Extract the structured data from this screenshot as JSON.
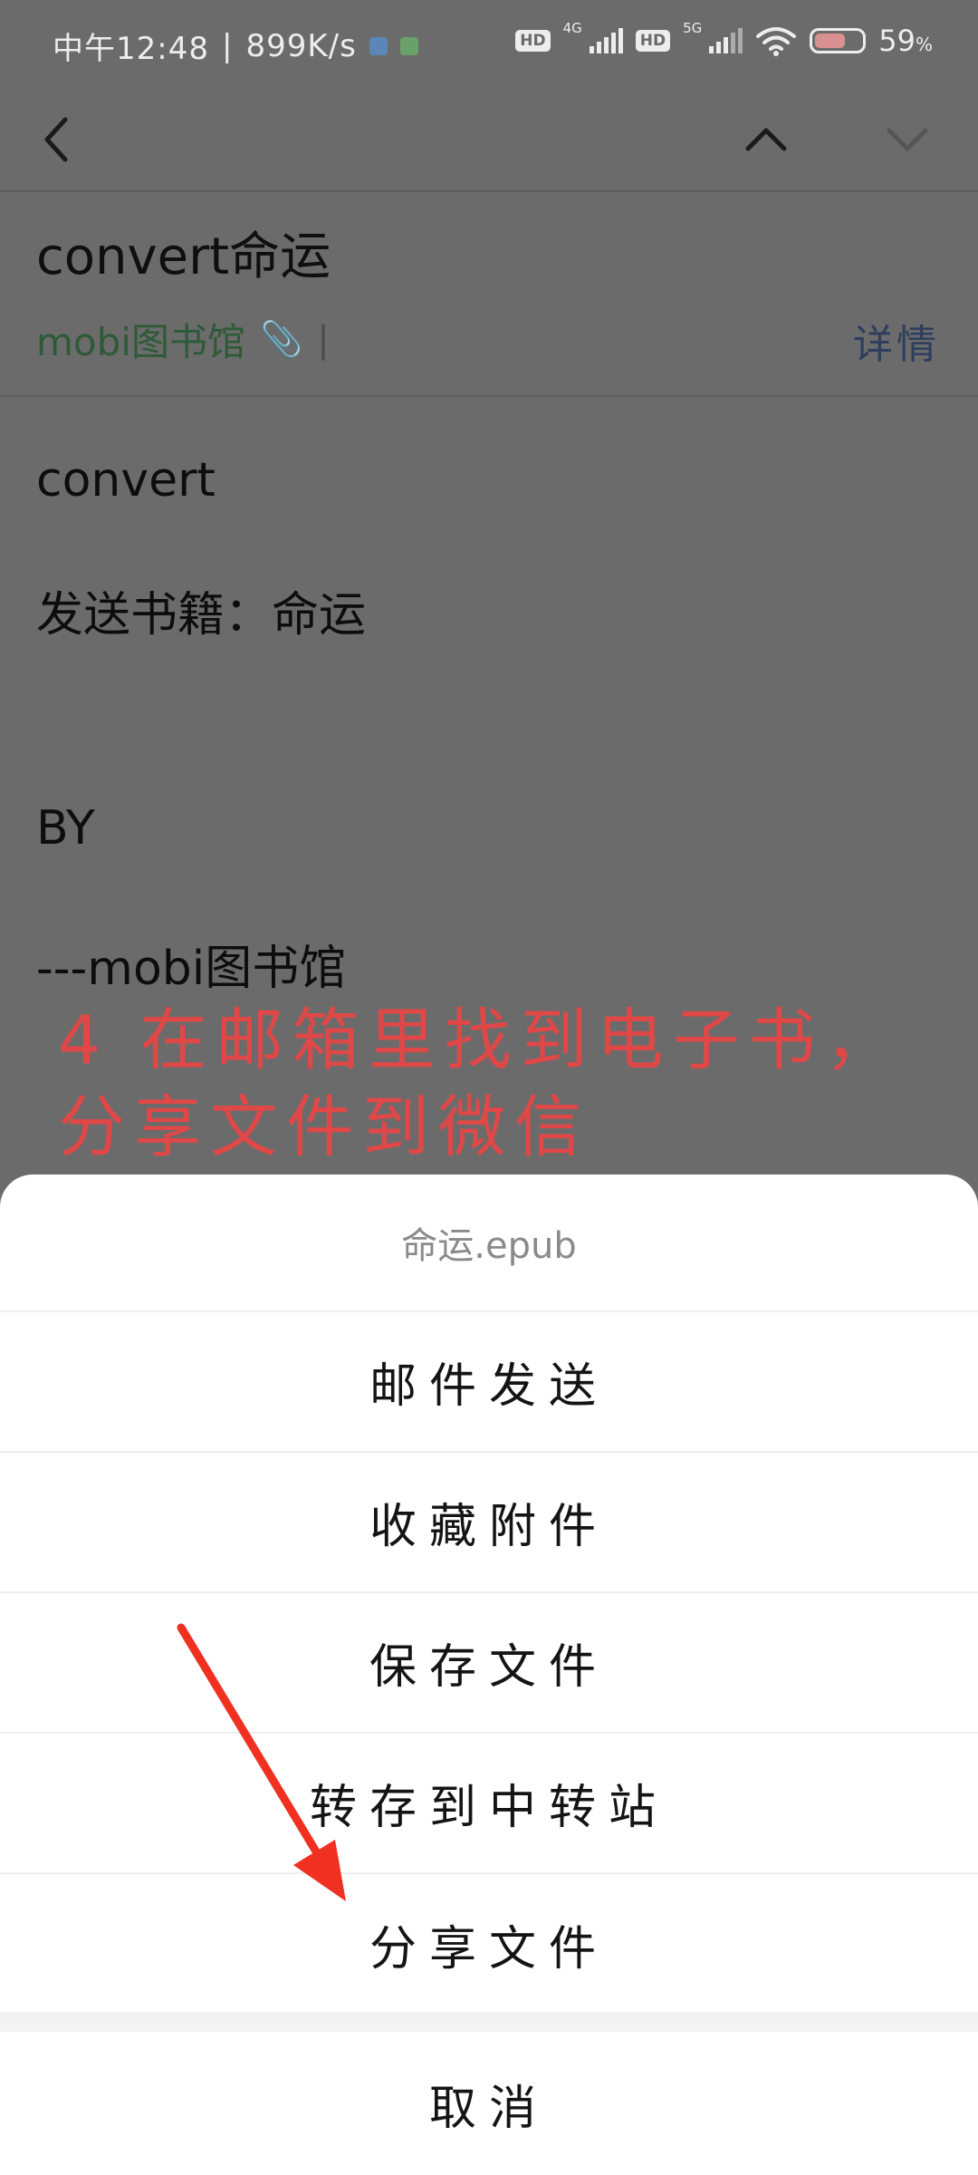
{
  "status_bar": {
    "time": "中午12:48",
    "net_speed": "899K/s",
    "sim1_hd": "HD",
    "sim1_net": "4G",
    "sim2_hd": "HD",
    "sim2_net": "5G",
    "battery_text": "59",
    "battery_unit": "%"
  },
  "mail": {
    "subject": "convert命运",
    "sender": "mobi图书馆",
    "details_label": "详情"
  },
  "body": {
    "lines": [
      "convert",
      "发送书籍：命运",
      "BY",
      "---mobi图书馆"
    ]
  },
  "annotation": {
    "line1": "4 在邮箱里找到电子书，",
    "line2": "分享文件到微信"
  },
  "sheet": {
    "title": "命运.epub",
    "items": [
      "邮件发送",
      "收藏附件",
      "保存文件",
      "转存到中转站",
      "分享文件"
    ],
    "cancel": "取消"
  },
  "colors": {
    "annotation": "#e04848",
    "arrow": "#f03020",
    "sender": "#2f5a37",
    "details": "#2e3e5e"
  }
}
